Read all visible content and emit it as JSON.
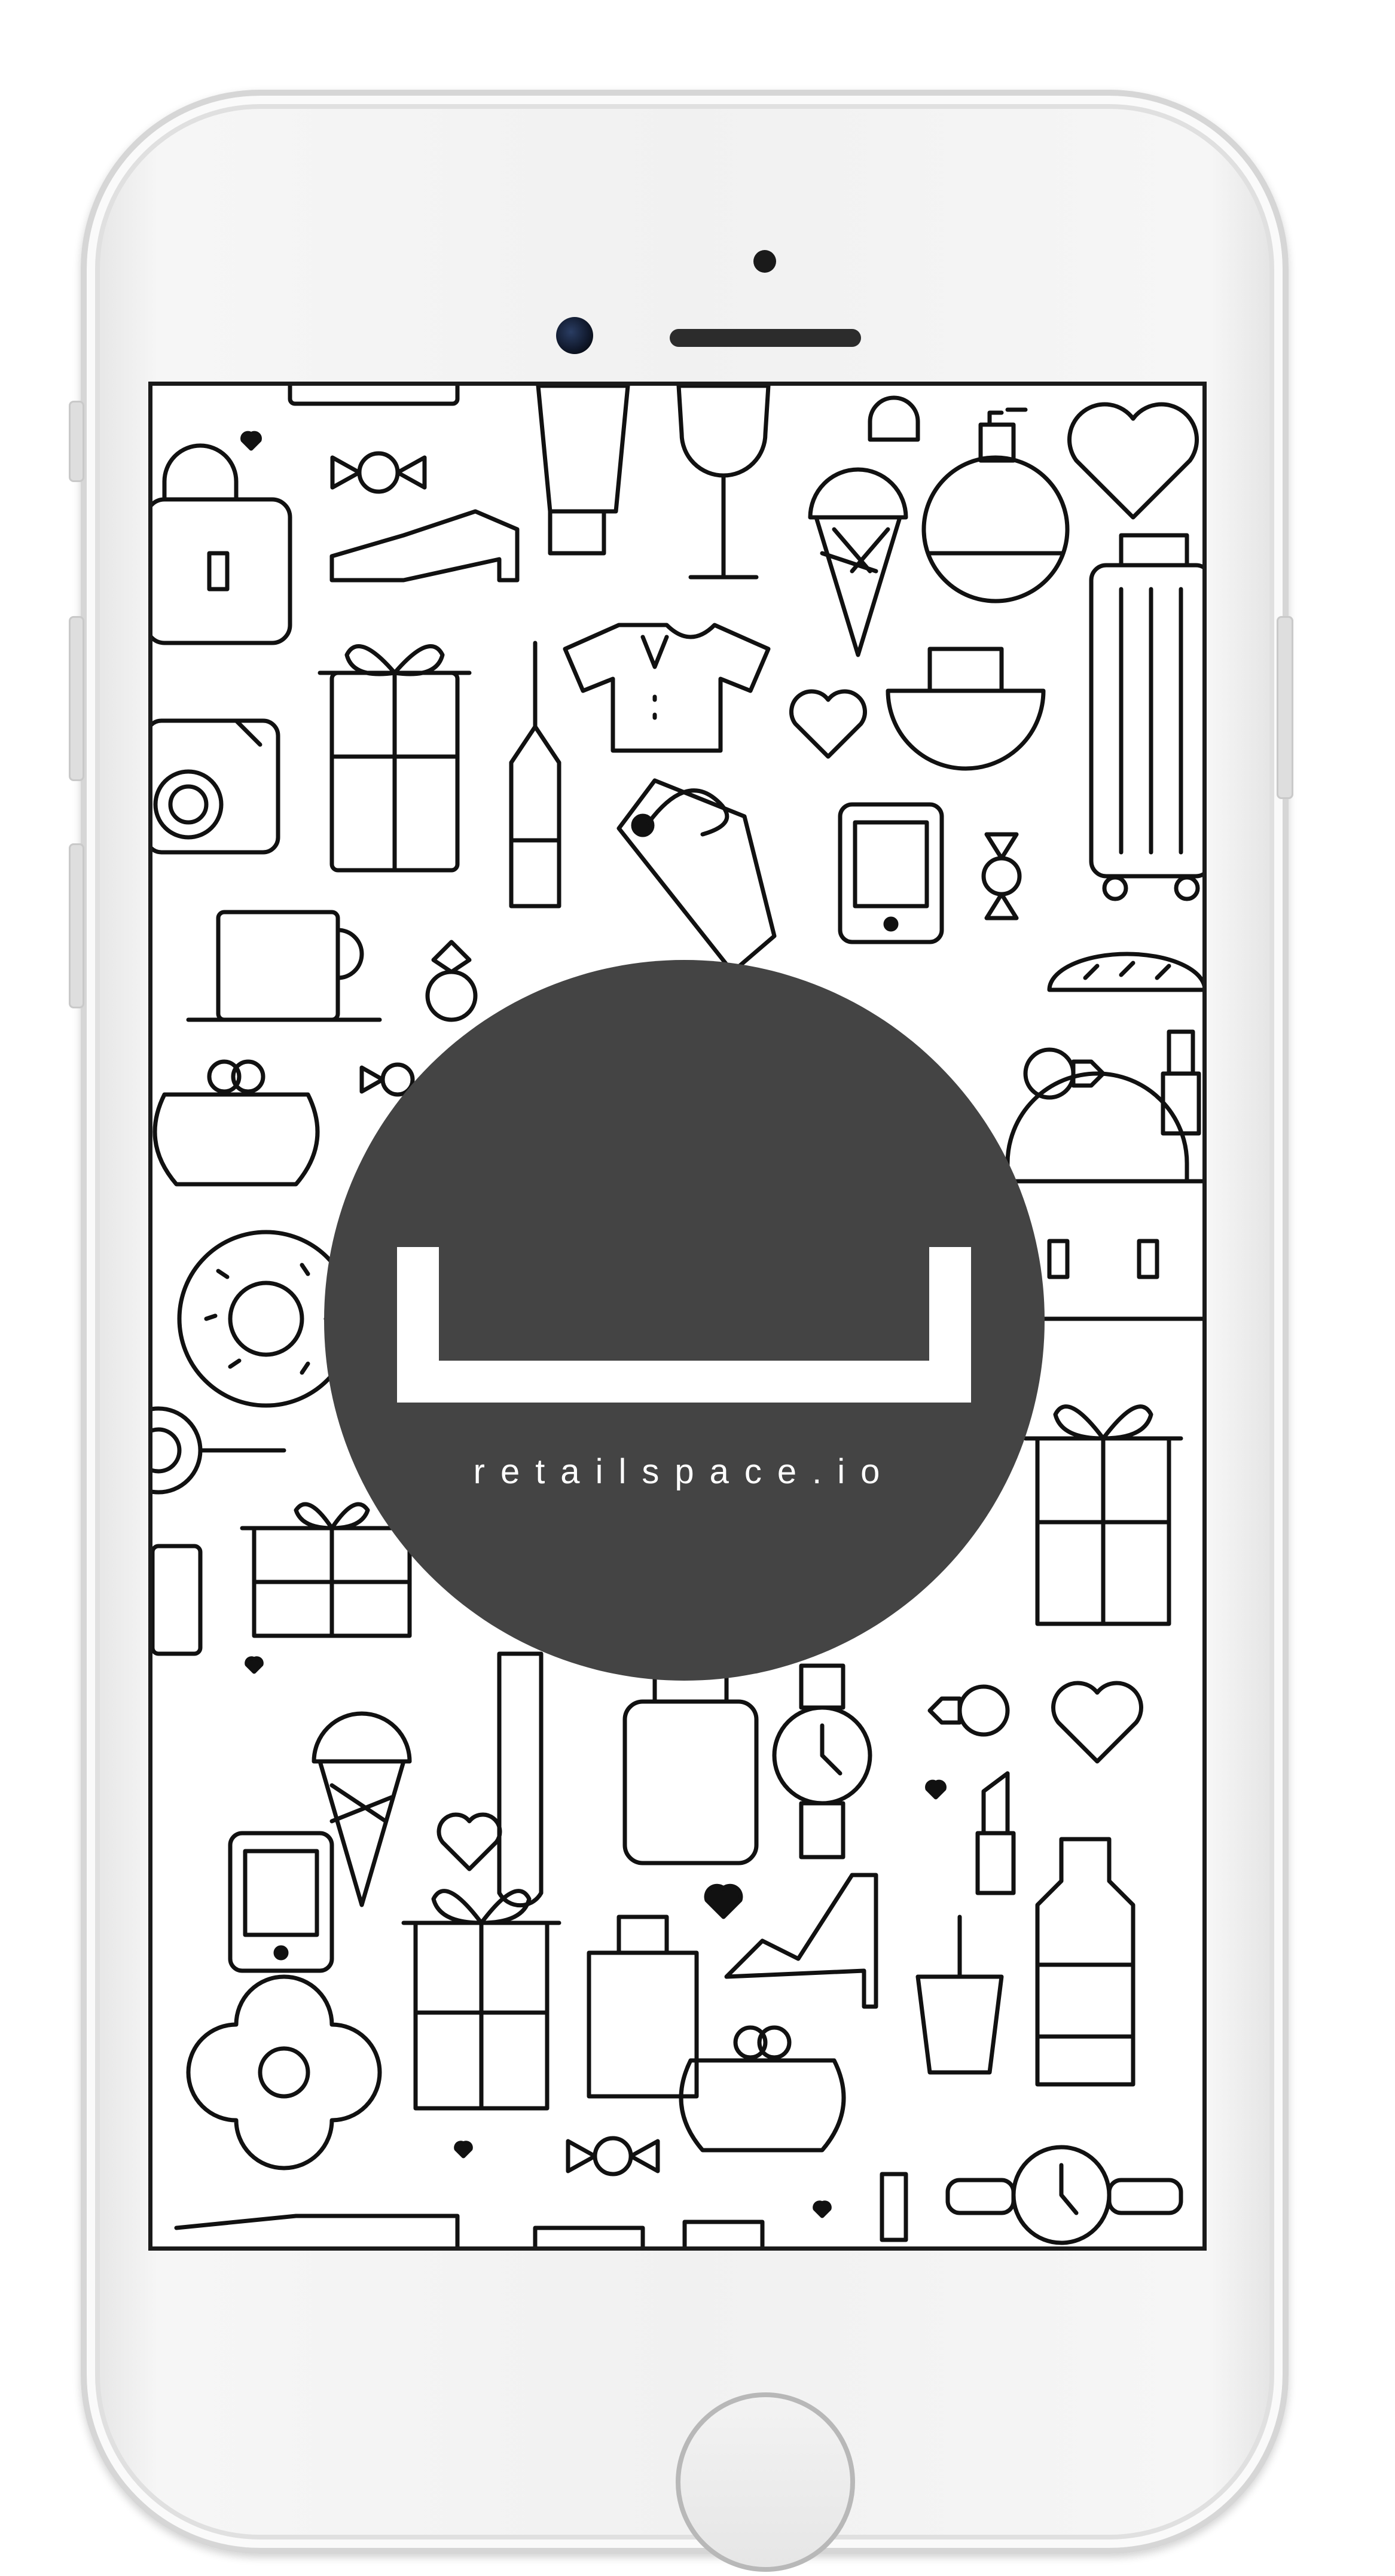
{
  "app": {
    "brand_text": "retailspace.io"
  },
  "colors": {
    "logo_circle": "#444444",
    "logo_foreground": "#ffffff",
    "icon_stroke": "#111111",
    "device_body": "#f1f1f1"
  },
  "icons": [
    "heart-icon",
    "candy-icon",
    "handbag-icon",
    "shoe-icon",
    "tube-icon",
    "wine-glass-icon",
    "ice-cream-icon",
    "perfume-icon",
    "suitcase-icon",
    "gift-icon",
    "tshirt-icon",
    "bottle-icon",
    "camera-icon",
    "tag-icon",
    "phone-icon",
    "cup-icon",
    "ring-icon",
    "purse-icon",
    "donut-icon",
    "watch-icon",
    "lipstick-icon",
    "high-heel-icon",
    "shopping-bag-icon",
    "comb-icon",
    "flower-cookie-icon"
  ]
}
